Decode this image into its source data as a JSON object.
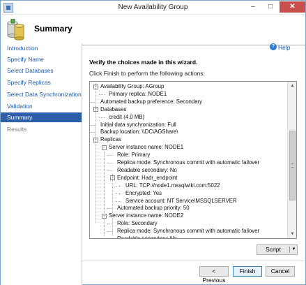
{
  "window": {
    "title": "New Availability Group",
    "close_label": "✕",
    "minimize_label": "–",
    "maximize_label": "□"
  },
  "header": {
    "title": "Summary"
  },
  "sidebar": {
    "items": [
      {
        "label": "Introduction",
        "state": "link"
      },
      {
        "label": "Specify Name",
        "state": "link"
      },
      {
        "label": "Select Databases",
        "state": "link"
      },
      {
        "label": "Specify Replicas",
        "state": "link"
      },
      {
        "label": "Select Data Synchronization",
        "state": "link"
      },
      {
        "label": "Validation",
        "state": "link"
      },
      {
        "label": "Summary",
        "state": "active"
      },
      {
        "label": "Results",
        "state": "disabled"
      }
    ]
  },
  "help": {
    "label": "Help",
    "icon": "question-icon"
  },
  "main": {
    "heading": "Verify the choices made in this wizard.",
    "subheading": "Click Finish to perform the following actions:"
  },
  "tree": {
    "rows": [
      {
        "text": "Availability Group: AGroup",
        "level": 0,
        "expander": "-"
      },
      {
        "text": "Primary replica: NODE1",
        "level": 1,
        "expander": ""
      },
      {
        "text": "Automated backup preference: Secondary",
        "level": 0,
        "expander": ""
      },
      {
        "text": "Databases",
        "level": 0,
        "expander": "-"
      },
      {
        "text": "credit (4.0 MB)",
        "level": 1,
        "expander": ""
      },
      {
        "text": "Initial data synchronization: Full",
        "level": 0,
        "expander": ""
      },
      {
        "text": "Backup location: \\\\DC\\AGShare\\",
        "level": 0,
        "expander": ""
      },
      {
        "text": "Replicas",
        "level": 0,
        "expander": "-"
      },
      {
        "text": "Server instance name: NODE1",
        "level": 1,
        "expander": "-"
      },
      {
        "text": "Role: Primary",
        "level": 2,
        "expander": ""
      },
      {
        "text": "Replica mode: Synchronous commit with automatic failover",
        "level": 2,
        "expander": ""
      },
      {
        "text": "Readable secondary: No",
        "level": 2,
        "expander": ""
      },
      {
        "text": "Endpoint: Hadr_endpoint",
        "level": 2,
        "expander": "-"
      },
      {
        "text": "URL: TCP://node1.mssqlwiki.com:5022",
        "level": 3,
        "expander": ""
      },
      {
        "text": "Encrypted: Yes",
        "level": 3,
        "expander": ""
      },
      {
        "text": "Service account: NT Service\\MSSQLSERVER",
        "level": 3,
        "expander": ""
      },
      {
        "text": "Automated backup priority: 50",
        "level": 2,
        "expander": ""
      },
      {
        "text": "Server instance name: NODE2",
        "level": 1,
        "expander": "-"
      },
      {
        "text": "Role: Secondary",
        "level": 2,
        "expander": ""
      },
      {
        "text": "Replica mode: Synchronous commit with automatic failover",
        "level": 2,
        "expander": ""
      },
      {
        "text": "Readable secondary: No",
        "level": 2,
        "expander": ""
      }
    ]
  },
  "buttons": {
    "script": "Script",
    "previous": "< Previous",
    "finish": "Finish",
    "cancel": "Cancel"
  }
}
